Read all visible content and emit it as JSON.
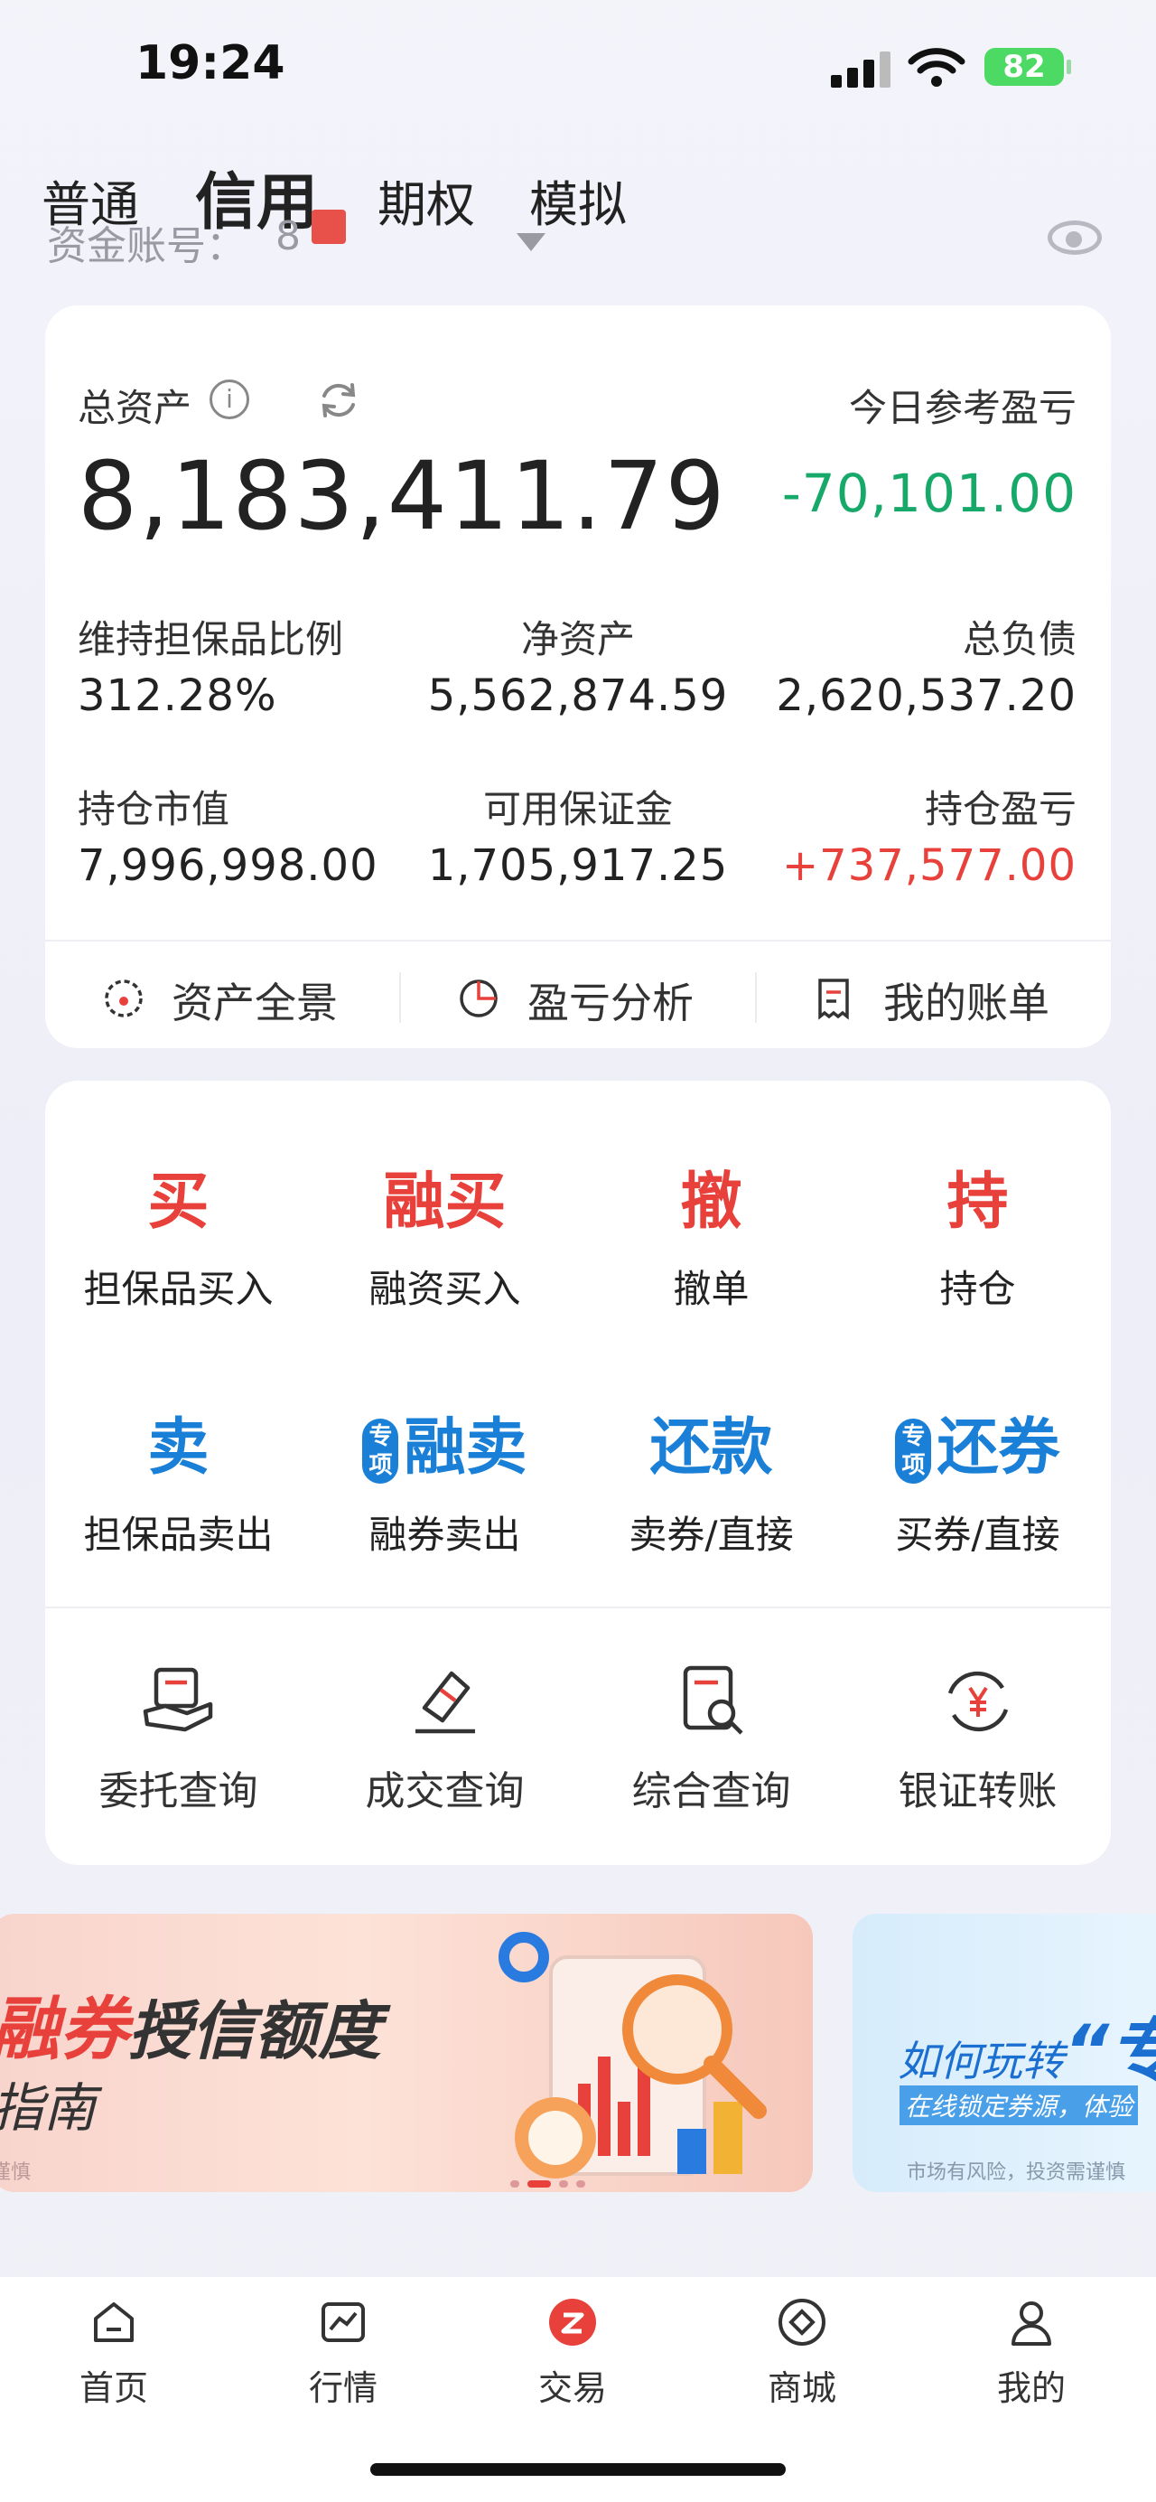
{
  "status_bar": {
    "time": "19:24",
    "battery": "82"
  },
  "tabs": [
    {
      "label": "普通",
      "active": false
    },
    {
      "label": "信用",
      "active": true
    },
    {
      "label": "期权",
      "active": false
    },
    {
      "label": "模拟",
      "active": false
    }
  ],
  "account": {
    "label": "资金账号：",
    "number": "8"
  },
  "summary": {
    "total_assets_label": "总资产",
    "total_assets": "8,183,411.79",
    "today_pnl_label": "今日参考盈亏",
    "today_pnl": "-70,101.00",
    "metrics": [
      {
        "label": "维持担保品比例",
        "value": "312.28%"
      },
      {
        "label": "净资产",
        "value": "5,562,874.59"
      },
      {
        "label": "总负债",
        "value": "2,620,537.20"
      },
      {
        "label": "持仓市值",
        "value": "7,996,998.00"
      },
      {
        "label": "可用保证金",
        "value": "1,705,917.25"
      },
      {
        "label": "持仓盈亏",
        "value": "+737,577.00"
      }
    ],
    "links": [
      {
        "label": "资产全景",
        "icon": "gauge-icon"
      },
      {
        "label": "盈亏分析",
        "icon": "pie-chart-icon"
      },
      {
        "label": "我的账单",
        "icon": "receipt-icon"
      }
    ]
  },
  "trade": {
    "row1": [
      {
        "big": "买",
        "sub": "担保品买入",
        "color": "#e8403a"
      },
      {
        "big": "融买",
        "sub": "融资买入",
        "color": "#e8403a"
      },
      {
        "big": "撤",
        "sub": "撤单",
        "color": "#e8403a"
      },
      {
        "big": "持",
        "sub": "持仓",
        "color": "#e8403a"
      }
    ],
    "row2": [
      {
        "big": "卖",
        "sub": "担保品卖出",
        "color": "#1a7fd6"
      },
      {
        "big": "融卖",
        "sub": "融券卖出",
        "color": "#1a7fd6",
        "badge": "专项"
      },
      {
        "big": "还款",
        "sub": "卖券/直接",
        "color": "#1a7fd6"
      },
      {
        "big": "还券",
        "sub": "买券/直接",
        "color": "#1a7fd6",
        "badge": "专项"
      }
    ],
    "queries": [
      {
        "label": "委托查询",
        "icon": "order-query-icon"
      },
      {
        "label": "成交查询",
        "icon": "deal-query-icon"
      },
      {
        "label": "综合查询",
        "icon": "search-doc-icon"
      },
      {
        "label": "银证转账",
        "icon": "yen-transfer-icon"
      }
    ]
  },
  "banners": {
    "b1": {
      "title_strong": "融券",
      "title": "授信额度",
      "subtitle": "指南",
      "note": "谨慎"
    },
    "b2": {
      "title": "如何玩转",
      "title_strong": "“专",
      "subtitle": "在线锁定券源，体验",
      "note": "市场有风险，投资需谨慎"
    }
  },
  "nav": [
    {
      "label": "首页",
      "icon": "home-icon"
    },
    {
      "label": "行情",
      "icon": "chart-icon"
    },
    {
      "label": "交易",
      "icon": "trade-icon"
    },
    {
      "label": "商城",
      "icon": "store-icon"
    },
    {
      "label": "我的",
      "icon": "user-icon"
    }
  ],
  "colors": {
    "red": "#e8403a",
    "green": "#16a96a",
    "blue": "#1a7fd6"
  }
}
